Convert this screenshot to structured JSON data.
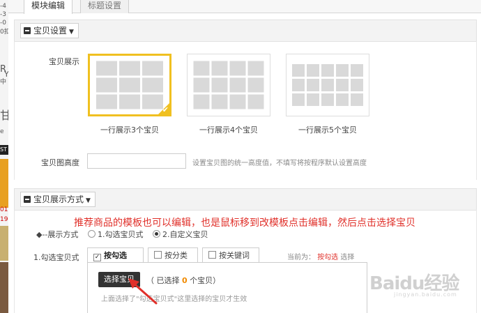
{
  "left_strip": {
    "fragments": [
      "-4",
      "-3",
      "-0",
      "0扣",
      "R",
      "Y",
      "中",
      "甘",
      "e",
      "ST",
      "01",
      "19"
    ]
  },
  "tabs": [
    {
      "label": "模块编辑",
      "active": true
    },
    {
      "label": "标题设置",
      "active": false
    }
  ],
  "section1": {
    "title": "宝贝设置",
    "display_label": "宝贝展示",
    "layouts": [
      {
        "caption": "一行展示3个宝贝",
        "columns": 3,
        "selected": true
      },
      {
        "caption": "一行展示4个宝贝",
        "columns": 4,
        "selected": false
      },
      {
        "caption": "一行展示5个宝贝",
        "columns": 5,
        "selected": false
      }
    ],
    "height_label": "宝贝图高度",
    "height_value": "",
    "height_hint": "设置宝贝图的统一高度值，不填写将按程序默认设置高度"
  },
  "section2": {
    "title": "宝贝展示方式",
    "annotation": "推荐商品的模板也可以编辑，也是鼠标移到改模板点击编辑，然后点击选择宝贝",
    "mode_label": "◆--展示方式",
    "mode_options": [
      {
        "label": "1.勾选宝贝式",
        "checked": false
      },
      {
        "label": "2.自定义宝贝",
        "checked": true
      }
    ],
    "pick_label": "1.勾选宝贝式",
    "sub_tabs": [
      {
        "label": "按勾选",
        "checked": true
      },
      {
        "label": "按分类",
        "checked": false
      },
      {
        "label": "按关键词",
        "checked": false
      }
    ],
    "current_prefix": "当前为：",
    "current_value": "按勾选",
    "current_suffix": "选择",
    "select_button": "选择宝贝",
    "selected_prefix": "（ 已选择",
    "selected_count": "0",
    "selected_suffix": "个宝贝）",
    "note": "上面选择了\"勾选宝贝式\"这里选择的宝贝才生效"
  },
  "watermark": {
    "text": "Baidu经验",
    "sub": "jingyan.baidu.com"
  },
  "colors": {
    "selected_border": "#f0c020",
    "annotation_red": "#e0302a",
    "count_orange": "#f08a00"
  },
  "icons": [
    "minus-icon",
    "caret-down-icon",
    "check-icon",
    "radio-icon",
    "checkbox-icon",
    "arrow-pointer-icon"
  ]
}
